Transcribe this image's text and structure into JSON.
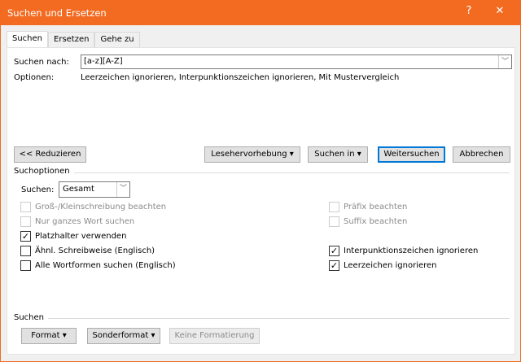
{
  "window": {
    "title": "Suchen und Ersetzen",
    "help": "?",
    "close": "✕",
    "accent": "#f26b21"
  },
  "tabs": [
    {
      "label": "Suchen",
      "active": true
    },
    {
      "label": "Ersetzen"
    },
    {
      "label": "Gehe zu"
    }
  ],
  "search": {
    "label": "Suchen nach:",
    "value": "[a-z][A-Z]",
    "options_label": "Optionen:",
    "options_value": "Leerzeichen ignorieren, Interpunktionszeichen ignorieren, Mit Mustervergleich"
  },
  "buttons": {
    "reduce": "<< Reduzieren",
    "highlight": "Lesehervorhebung ▾",
    "search_in": "Suchen in ▾",
    "find_next": "Weitersuchen",
    "cancel": "Abbrechen"
  },
  "search_options": {
    "heading": "Suchoptionen",
    "scope_label": "Suchen:",
    "scope_value": "Gesamt",
    "left": [
      {
        "label": "Groß-/Kleinschreibung beachten",
        "checked": false,
        "disabled": true
      },
      {
        "label": "Nur ganzes Wort suchen",
        "checked": false,
        "disabled": true
      },
      {
        "label": "Platzhalter verwenden",
        "checked": true
      },
      {
        "label": "Ähnl. Schreibweise (Englisch)",
        "checked": false
      },
      {
        "label": "Alle Wortformen suchen (Englisch)",
        "checked": false
      }
    ],
    "right": [
      {
        "label": "Präfix beachten",
        "checked": false,
        "disabled": true
      },
      {
        "label": "Suffix beachten",
        "checked": false,
        "disabled": true
      },
      {
        "label": "Interpunktionszeichen ignorieren",
        "checked": true
      },
      {
        "label": "Leerzeichen ignorieren",
        "checked": true
      }
    ]
  },
  "footer": {
    "heading": "Suchen",
    "format": "Format ▾",
    "special": "Sonderformat ▾",
    "no_format": "Keine Formatierung"
  }
}
